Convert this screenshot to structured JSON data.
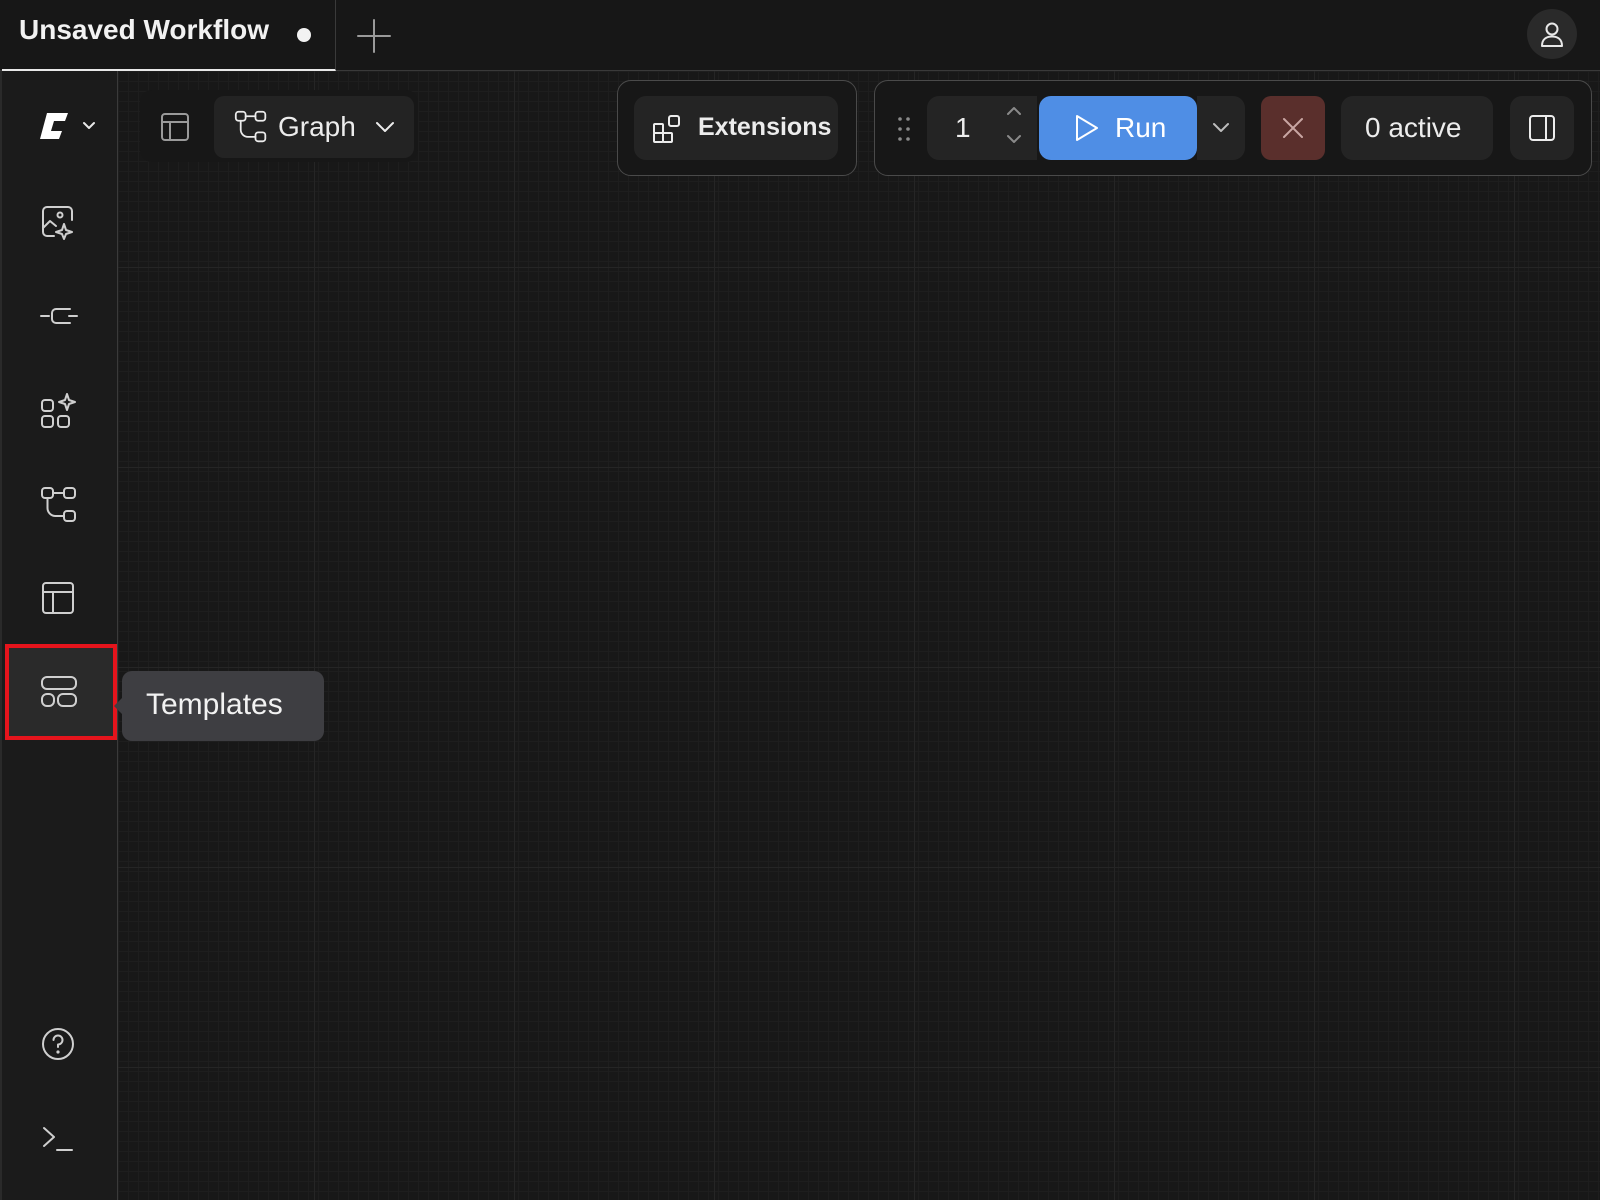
{
  "tabs": [
    {
      "title": "Unsaved Workflow",
      "unsaved": true
    }
  ],
  "toolbar": {
    "view_mode_label": "Graph",
    "extensions_label": "Extensions",
    "batch_count": "1",
    "run_label": "Run",
    "active_label": "0 active"
  },
  "tooltip": {
    "text": "Templates"
  },
  "sidebar": {
    "items": [
      {
        "icon": "image-sparkle-icon"
      },
      {
        "icon": "model-library-icon"
      },
      {
        "icon": "node-library-icon"
      },
      {
        "icon": "workflows-icon"
      },
      {
        "icon": "queue-layout-icon"
      },
      {
        "icon": "templates-icon",
        "active": true
      }
    ],
    "bottom_items": [
      {
        "icon": "help-icon"
      },
      {
        "icon": "terminal-icon"
      }
    ]
  },
  "colors": {
    "background": "#171717",
    "run_button": "#4f8ee5",
    "cancel_button": "#5a2f2c",
    "highlight": "#e5141c",
    "tooltip": "#3e3e42"
  }
}
